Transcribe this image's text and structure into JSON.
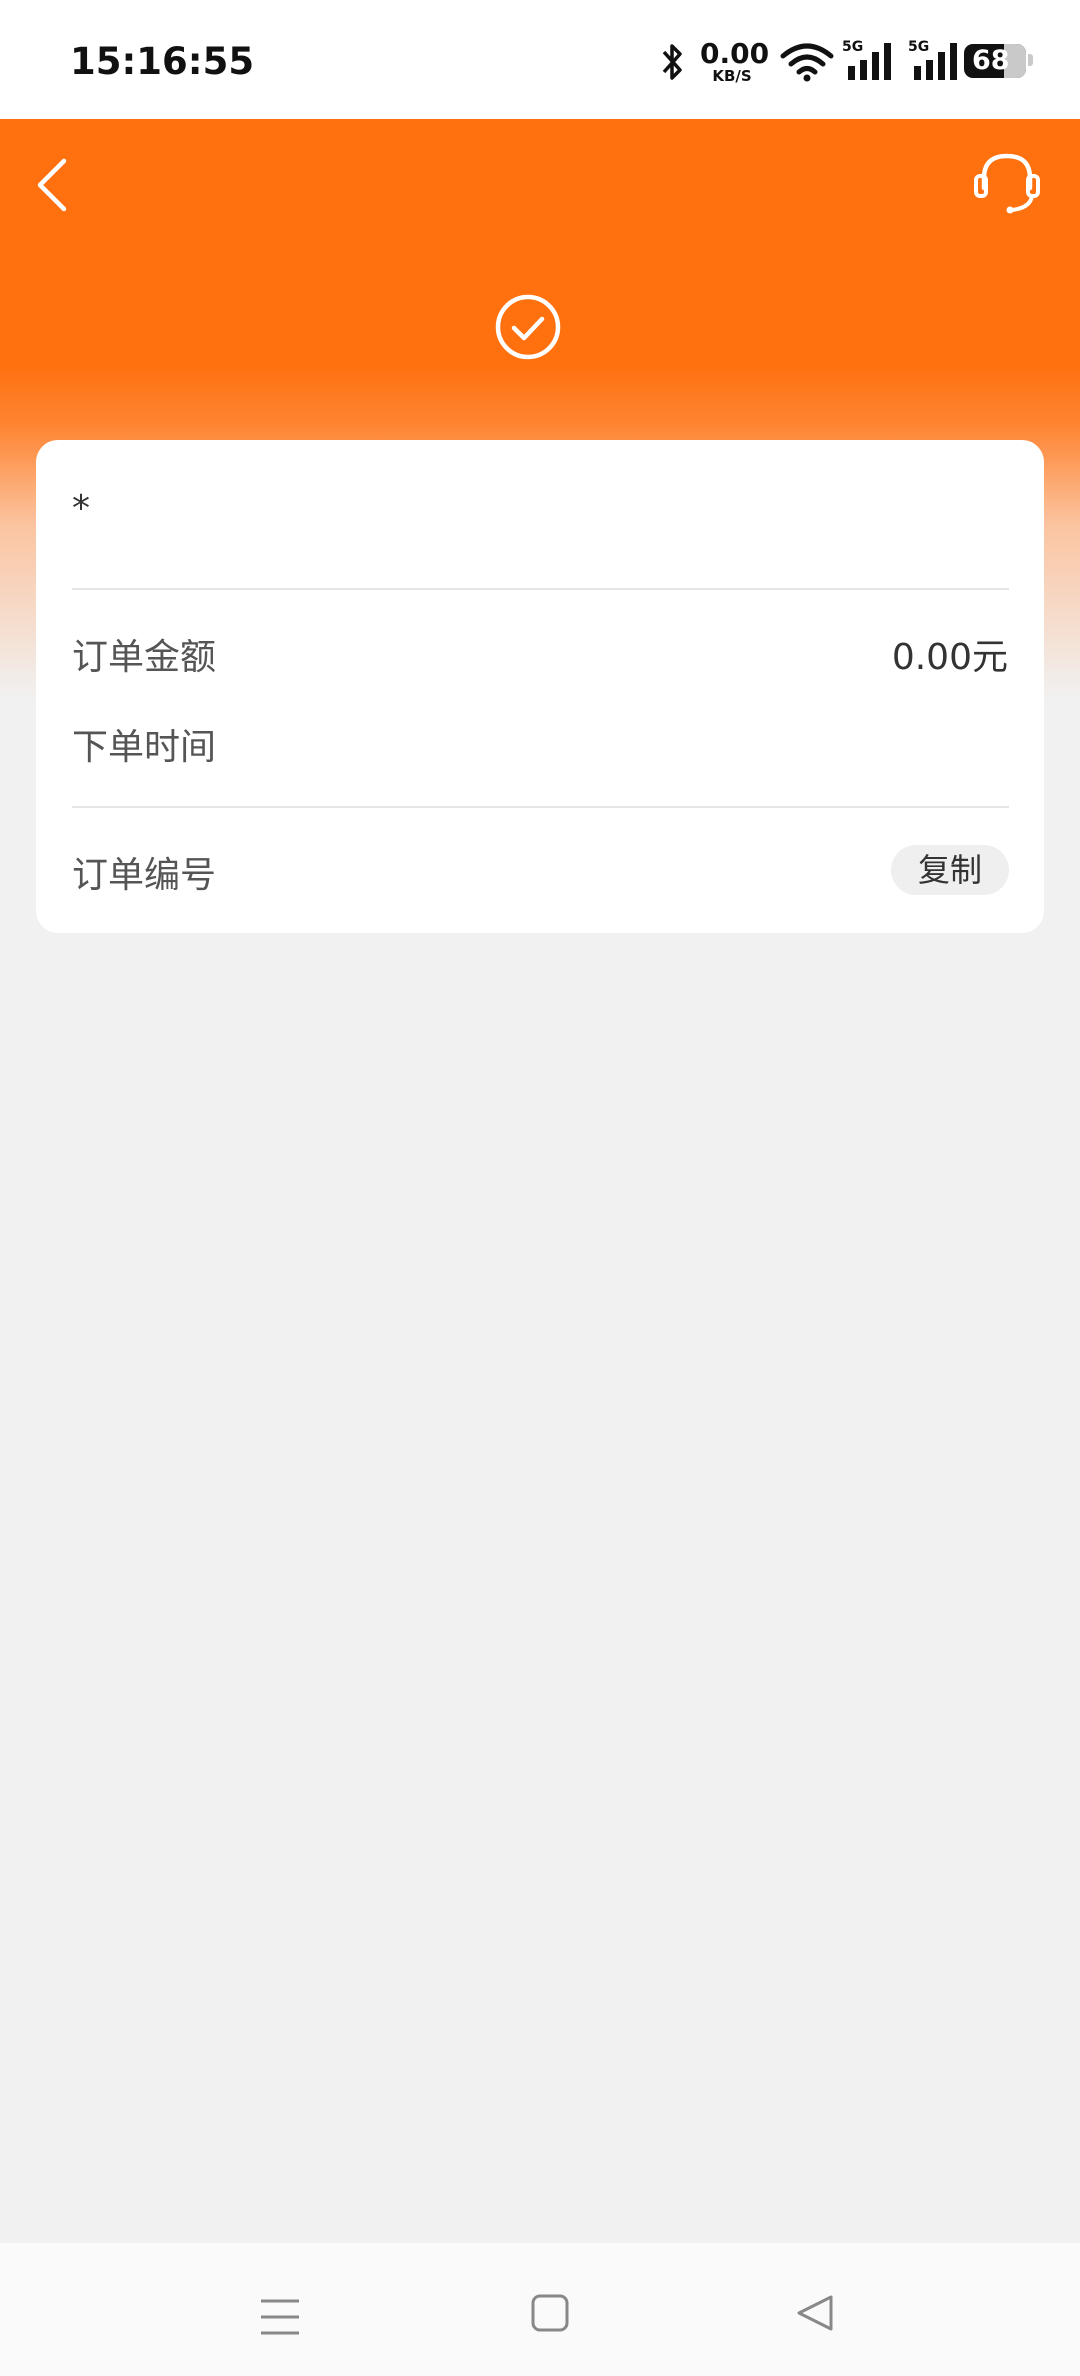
{
  "status_bar": {
    "time": "15:16:55",
    "net_speed_value": "0.00",
    "net_speed_unit": "KB/S",
    "signal1_label": "5G",
    "signal2_label": "5G",
    "battery": "68",
    "icons": [
      "bluetooth-icon",
      "wifi-icon",
      "signal-icon",
      "battery-icon"
    ]
  },
  "header": {
    "back_icon": "chevron-left-icon",
    "service_icon": "headset-icon",
    "status_icon": "check-circle-icon",
    "color": "#ff700e"
  },
  "order": {
    "product_name": "*",
    "amount_label": "订单金额",
    "amount_value": "0.00元",
    "time_label": "下单时间",
    "number_label": "订单编号",
    "copy_label": "复制"
  },
  "nav_bar": {
    "icons": [
      "menu-icon",
      "home-icon",
      "back-icon"
    ]
  }
}
